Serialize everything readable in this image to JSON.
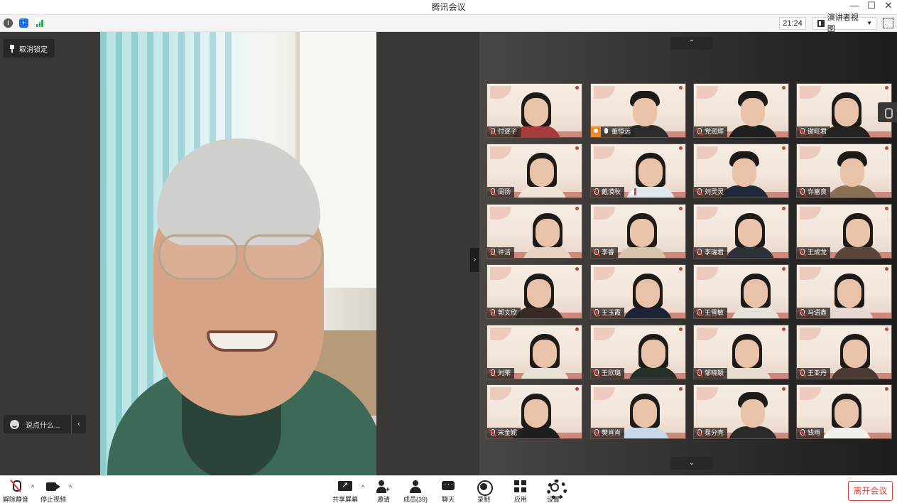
{
  "window": {
    "title": "腾讯会议"
  },
  "topbar": {
    "icons": [
      "info-icon",
      "shield-icon",
      "signal-icon"
    ],
    "timer": "21:24",
    "view_mode": "演讲者视图"
  },
  "main": {
    "unpin_label": "取消锁定",
    "chat_placeholder": "说点什么...",
    "collapse_arrow": "‹",
    "panel_toggle": "›"
  },
  "gallery": {
    "scroll_up": "⌃",
    "scroll_down": "⌄",
    "participants": [
      {
        "name": "付逐子",
        "mic": "off"
      },
      {
        "name": "董恒远",
        "mic": "on",
        "host": true
      },
      {
        "name": "党润辉",
        "mic": "off"
      },
      {
        "name": "谢旺君",
        "mic": "off"
      },
      {
        "name": "周扬",
        "mic": "off"
      },
      {
        "name": "戴漠秋",
        "mic": "off",
        "speaking": true
      },
      {
        "name": "刘灵灵",
        "mic": "off"
      },
      {
        "name": "许嘉良",
        "mic": "off"
      },
      {
        "name": "许洁",
        "mic": "off"
      },
      {
        "name": "李睿",
        "mic": "off"
      },
      {
        "name": "李瑞君",
        "mic": "off"
      },
      {
        "name": "王成龙",
        "mic": "off"
      },
      {
        "name": "郭文欣",
        "mic": "off"
      },
      {
        "name": "王玉霞",
        "mic": "off"
      },
      {
        "name": "王雪敏",
        "mic": "off"
      },
      {
        "name": "马语鑫",
        "mic": "off"
      },
      {
        "name": "刘荣",
        "mic": "off"
      },
      {
        "name": "王欣璐",
        "mic": "off"
      },
      {
        "name": "邹晓颖",
        "mic": "off"
      },
      {
        "name": "王亚丹",
        "mic": "off"
      },
      {
        "name": "宋金妮",
        "mic": "off"
      },
      {
        "name": "樊肖肖",
        "mic": "off"
      },
      {
        "name": "易分亮",
        "mic": "off"
      },
      {
        "name": "钱雨",
        "mic": "off"
      }
    ]
  },
  "toolbar": {
    "unmute": "解除静音",
    "stop_video": "停止视频",
    "share_screen": "共享屏幕",
    "invite": "邀请",
    "members": "成员(39)",
    "chat": "聊天",
    "record": "录制",
    "apps": "应用",
    "settings": "设置",
    "leave": "离开会议",
    "caret": "^"
  },
  "colors": {
    "accent_red": "#e0403a",
    "host_orange": "#f08a28",
    "main_bg": "#3b3734",
    "gallery_bg": "#2e2c2b"
  }
}
